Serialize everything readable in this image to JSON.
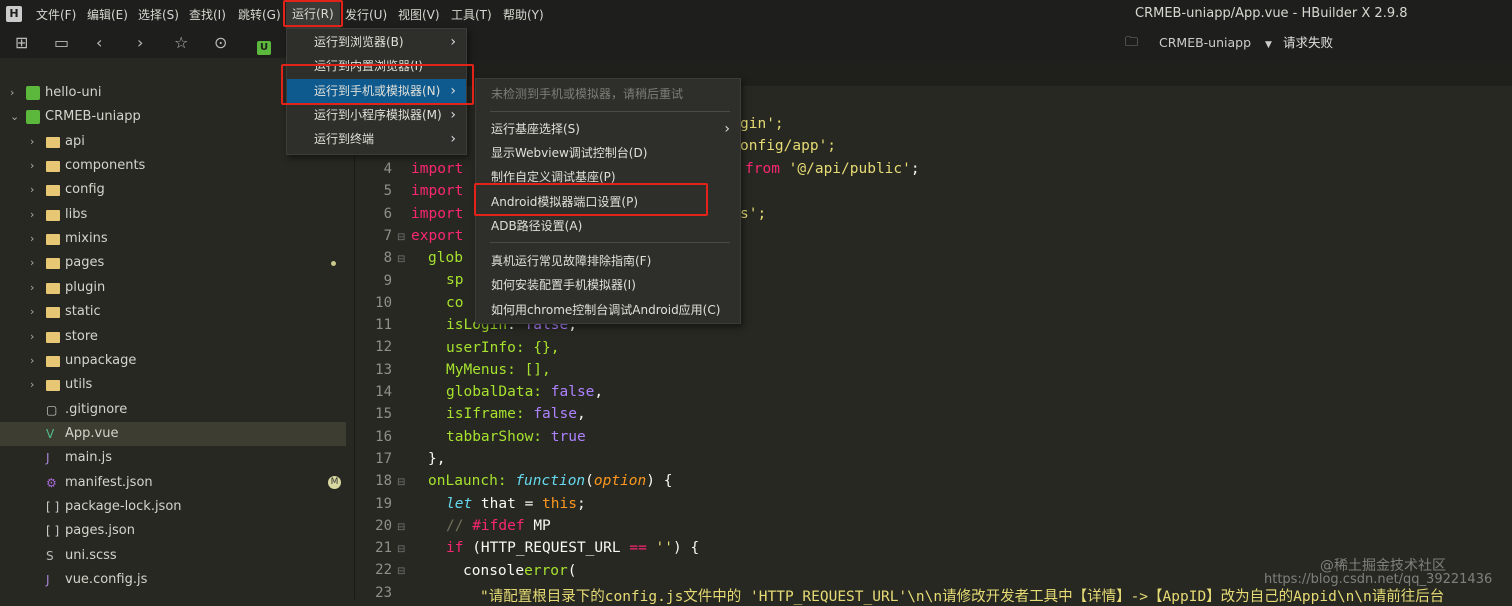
{
  "app": {
    "title": "CRMEB-uniapp/App.vue - HBuilder X 2.9.8",
    "logo": "H"
  },
  "menubar": [
    "文件(F)",
    "编辑(E)",
    "选择(S)",
    "查找(I)",
    "跳转(G)",
    "运行(R)",
    "发行(U)",
    "视图(V)",
    "工具(T)",
    "帮助(Y)"
  ],
  "toolbar": {
    "project": "CRMEB-uniapp",
    "status": "请求失败",
    "u_badge": "U"
  },
  "run_menu": [
    {
      "label": "运行到浏览器(B)"
    },
    {
      "label": "运行到内置浏览器(I)"
    },
    {
      "label": "运行到手机或模拟器(N)"
    },
    {
      "label": "运行到小程序模拟器(M)"
    },
    {
      "label": "运行到终端"
    }
  ],
  "device_submenu": {
    "disabled": "未检测到手机或模拟器，请稍后重试",
    "items": [
      "运行基座选择(S)",
      "显示Webview调试控制台(D)",
      "制作自定义调试基座(P)",
      "Android模拟器端口设置(P)",
      "ADB路径设置(A)",
      "真机运行常见故障排除指南(F)",
      "如何安装配置手机模拟器(I)",
      "如何用chrome控制台调试Android应用(C)"
    ]
  },
  "sidebar": {
    "items": [
      "hello-uni",
      "CRMEB-uniapp",
      "api",
      "components",
      "config",
      "libs",
      "mixins",
      "pages",
      "plugin",
      "static",
      "store",
      "unpackage",
      "utils",
      ".gitignore",
      "App.vue",
      "main.js",
      "manifest.json",
      "package-lock.json",
      "pages.json",
      "uni.scss",
      "vue.config.js"
    ],
    "badge_m": "M"
  },
  "editor": {
    "line_numbers": [
      "4",
      "5",
      "6",
      "7",
      "8",
      "9",
      "10",
      "11",
      "12",
      "13",
      "14",
      "15",
      "16",
      "17",
      "18",
      "19",
      "20",
      "21",
      "22",
      "23"
    ],
    "frag": {
      "l1": "gin';",
      "l2": "onfig/app';",
      "l4a": "import",
      "l4b": "from",
      "l4c": "'@/api/public'",
      "l4d": ";",
      "l5": "import",
      "l6a": "import",
      "l6b": "s';",
      "l7": "export",
      "l8": "glob",
      "l9": "sp",
      "l10": "co",
      "l11a": "isLogin",
      "l11b": ": ",
      "l11c": "false",
      "l11d": ",",
      "l12": "userInfo: {},",
      "l13": "MyMenus: [],",
      "l14a": "globalData: ",
      "l14b": "false",
      "l14c": ",",
      "l15a": "isIframe: ",
      "l15b": "false",
      "l15c": ",",
      "l16a": "tabbarShow: ",
      "l16b": "true",
      "l17": "},",
      "l18a": "onLaunch: ",
      "l18b": "function",
      "l18c": "(",
      "l18d": "option",
      "l18e": ") {",
      "l19a": "let",
      "l19b": " that = ",
      "l19c": "this",
      "l19d": ";",
      "l20a": "// ",
      "l20b": "#ifdef",
      "l20c": " MP",
      "l21a": "if",
      "l21b": " (HTTP_REQUEST_URL ",
      "l21c": "==",
      "l21d": " ",
      "l21e": "''",
      "l21f": ") {",
      "l22a": "console",
      ".": ".",
      "l22b": "error",
      "l22c": "(",
      "l23": "\"请配置根目录下的config.js文件中的 'HTTP_REQUEST_URL'\\n\\n请修改开发者工具中【详情】->【AppID】改为自己的Appid\\n\\n请前往后台"
    }
  },
  "watermark": {
    "line1": "@稀土掘金技术社区",
    "line2": "https://blog.csdn.net/qq_39221436"
  }
}
